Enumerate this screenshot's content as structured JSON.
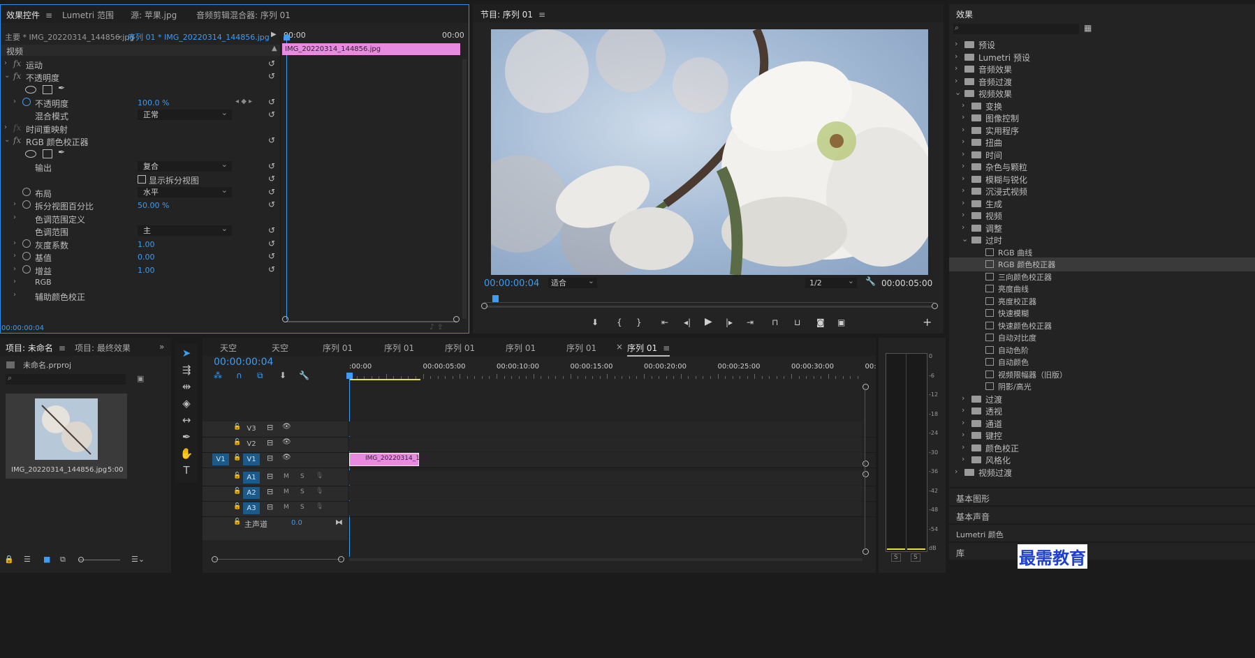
{
  "effect_controls": {
    "tabs": [
      "效果控件",
      "Lumetri 范围",
      "源: 苹果.jpg",
      "音频剪辑混合器: 序列 01"
    ],
    "master_label": "主要 * IMG_20220314_144856.jpg",
    "sequence_label": "序列 01 * IMG_20220314_144856.jpg",
    "mini_timeline": {
      "start": "00:00",
      "end": "00:00",
      "clip": "IMG_20220314_144856.jpg"
    },
    "section_video": "视频",
    "rows": {
      "motion": "运动",
      "opacity_group": "不透明度",
      "opacity": "不透明度",
      "opacity_value": "100.0 %",
      "blend_mode": "混合模式",
      "blend_mode_value": "正常",
      "time_remap": "时间重映射",
      "rgb_corrector": "RGB 颜色校正器",
      "output": "输出",
      "output_value": "复合",
      "show_split": "显示拆分视图",
      "layout": "布局",
      "layout_value": "水平",
      "split_percent": "拆分视图百分比",
      "split_percent_value": "50.00 %",
      "tonal_def": "色调范围定义",
      "tonal_range": "色调范围",
      "tonal_range_value": "主",
      "gamma": "灰度系数",
      "gamma_value": "1.00",
      "pedestal": "基值",
      "pedestal_value": "0.00",
      "gain": "增益",
      "gain_value": "1.00",
      "rgb": "RGB",
      "secondary": "辅助颜色校正"
    },
    "timecode": "00:00:00:04"
  },
  "program_monitor": {
    "title": "节目: 序列 01",
    "timecode": "00:00:00:04",
    "fit": "适合",
    "resolution": "1/2",
    "duration": "00:00:05:00"
  },
  "effects_panel": {
    "title": "效果",
    "search_placeholder": "",
    "tree": [
      {
        "label": "预设",
        "level": 0,
        "expanded": false,
        "type": "folder"
      },
      {
        "label": "Lumetri 预设",
        "level": 0,
        "expanded": false,
        "type": "folder"
      },
      {
        "label": "音频效果",
        "level": 0,
        "expanded": false,
        "type": "folder"
      },
      {
        "label": "音频过渡",
        "level": 0,
        "expanded": false,
        "type": "folder"
      },
      {
        "label": "视频效果",
        "level": 0,
        "expanded": true,
        "type": "folder"
      },
      {
        "label": "变换",
        "level": 1,
        "expanded": false,
        "type": "folder"
      },
      {
        "label": "图像控制",
        "level": 1,
        "expanded": false,
        "type": "folder"
      },
      {
        "label": "实用程序",
        "level": 1,
        "expanded": false,
        "type": "folder"
      },
      {
        "label": "扭曲",
        "level": 1,
        "expanded": false,
        "type": "folder"
      },
      {
        "label": "时间",
        "level": 1,
        "expanded": false,
        "type": "folder"
      },
      {
        "label": "杂色与颗粒",
        "level": 1,
        "expanded": false,
        "type": "folder"
      },
      {
        "label": "模糊与锐化",
        "level": 1,
        "expanded": false,
        "type": "folder"
      },
      {
        "label": "沉浸式视频",
        "level": 1,
        "expanded": false,
        "type": "folder"
      },
      {
        "label": "生成",
        "level": 1,
        "expanded": false,
        "type": "folder"
      },
      {
        "label": "视频",
        "level": 1,
        "expanded": false,
        "type": "folder"
      },
      {
        "label": "调整",
        "level": 1,
        "expanded": false,
        "type": "folder"
      },
      {
        "label": "过时",
        "level": 1,
        "expanded": true,
        "type": "folder"
      },
      {
        "label": "RGB 曲线",
        "level": 2,
        "type": "effect"
      },
      {
        "label": "RGB 颜色校正器",
        "level": 2,
        "type": "effect",
        "selected": true
      },
      {
        "label": "三向颜色校正器",
        "level": 2,
        "type": "effect"
      },
      {
        "label": "亮度曲线",
        "level": 2,
        "type": "effect"
      },
      {
        "label": "亮度校正器",
        "level": 2,
        "type": "effect"
      },
      {
        "label": "快速模糊",
        "level": 2,
        "type": "effect"
      },
      {
        "label": "快速颜色校正器",
        "level": 2,
        "type": "effect"
      },
      {
        "label": "自动对比度",
        "level": 2,
        "type": "effect"
      },
      {
        "label": "自动色阶",
        "level": 2,
        "type": "effect"
      },
      {
        "label": "自动颜色",
        "level": 2,
        "type": "effect"
      },
      {
        "label": "视频限幅器（旧版）",
        "level": 2,
        "type": "effect"
      },
      {
        "label": "阴影/高光",
        "level": 2,
        "type": "effect"
      },
      {
        "label": "过渡",
        "level": 1,
        "expanded": false,
        "type": "folder"
      },
      {
        "label": "透视",
        "level": 1,
        "expanded": false,
        "type": "folder"
      },
      {
        "label": "通道",
        "level": 1,
        "expanded": false,
        "type": "folder"
      },
      {
        "label": "键控",
        "level": 1,
        "expanded": false,
        "type": "folder"
      },
      {
        "label": "颜色校正",
        "level": 1,
        "expanded": false,
        "type": "folder"
      },
      {
        "label": "风格化",
        "level": 1,
        "expanded": false,
        "type": "folder"
      },
      {
        "label": "视频过渡",
        "level": 0,
        "expanded": false,
        "type": "folder"
      }
    ],
    "bottom_panels": [
      "基本图形",
      "基本声音",
      "Lumetri 颜色",
      "库"
    ]
  },
  "project_panel": {
    "tabs": [
      "项目: 未命名",
      "项目: 最终效果"
    ],
    "file": "未命名.prproj",
    "item_name": "IMG_20220314_144856.jpg",
    "item_duration": "5:00"
  },
  "timeline": {
    "tabs": [
      "天空",
      "天空",
      "序列 01",
      "序列 01",
      "序列 01",
      "序列 01",
      "序列 01",
      "序列 01"
    ],
    "timecode": "00:00:00:04",
    "ruler": [
      ":00:00",
      "00:00:05:00",
      "00:00:10:00",
      "00:00:15:00",
      "00:00:20:00",
      "00:00:25:00",
      "00:00:30:00",
      "00:00"
    ],
    "video_tracks": [
      "V3",
      "V2",
      "V1"
    ],
    "audio_tracks": [
      "A1",
      "A2",
      "A3"
    ],
    "source_v": "V1",
    "master": "主声道",
    "master_value": "0.0",
    "clip_label": "IMG_20220314_144",
    "mute": "M",
    "solo": "S"
  },
  "audio_meter": {
    "scale": [
      "0",
      "-6",
      "-12",
      "-18",
      "-24",
      "-30",
      "-36",
      "-42",
      "-48",
      "-54",
      "dB"
    ],
    "solo": [
      "S",
      "S"
    ]
  },
  "watermark": "最需教育",
  "colors": {
    "accent": "#3e9cf2",
    "clip": "#e88be0",
    "panel": "#232323"
  }
}
